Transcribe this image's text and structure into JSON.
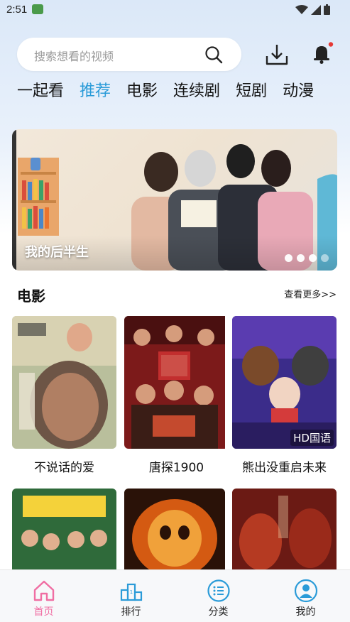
{
  "status": {
    "time": "2:51"
  },
  "search": {
    "placeholder": "搜索想看的视频"
  },
  "tabs": [
    "一起看",
    "推荐",
    "电影",
    "连续剧",
    "短剧",
    "动漫"
  ],
  "active_tab": 1,
  "banner": {
    "title": "我的后半生",
    "dots": 4,
    "active_dot": 0
  },
  "section": {
    "title": "电影",
    "more": "查看更多>>"
  },
  "movies": [
    {
      "name": "不说话的爱",
      "badge": ""
    },
    {
      "name": "唐探1900",
      "badge": ""
    },
    {
      "name": "熊出没重启未来",
      "badge": "HD国语"
    }
  ],
  "nav": [
    {
      "label": "首页",
      "icon": "home-icon",
      "active": true
    },
    {
      "label": "排行",
      "icon": "ranking-icon",
      "active": false
    },
    {
      "label": "分类",
      "icon": "category-icon",
      "active": false
    },
    {
      "label": "我的",
      "icon": "profile-icon",
      "active": false
    }
  ],
  "colors": {
    "accent": "#2a9bd8",
    "nav_active": "#f06ea3",
    "icon_blue": "#2a9bd8",
    "notification": "#e53935"
  }
}
